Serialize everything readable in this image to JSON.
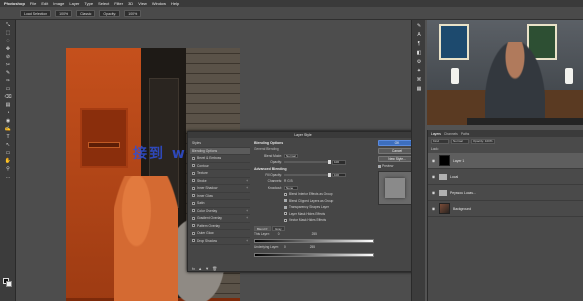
{
  "menubar": {
    "items": [
      "Photoshop",
      "File",
      "Edit",
      "Image",
      "Layer",
      "Type",
      "Select",
      "Filter",
      "3D",
      "View",
      "Window",
      "Help"
    ],
    "right": ""
  },
  "options": {
    "items": [
      "Load Selection",
      "100%",
      "Classic",
      "Opacity:",
      "100%"
    ]
  },
  "toolbar": {
    "tools": [
      "⤡",
      "⬚",
      "◌",
      "✥",
      "⊘",
      "✂",
      "✎",
      "✑",
      "▭",
      "⌫",
      "▤",
      "◔",
      "◉",
      "✍",
      "T",
      "↖",
      "▭",
      "✋",
      "⚲",
      "…"
    ]
  },
  "watermark": {
    "text": "接到 www.advers.cn"
  },
  "dialog": {
    "title": "Layer Style",
    "list": [
      {
        "label": "Styles",
        "checkbox": false,
        "plus": false,
        "selected": false
      },
      {
        "label": "Blending Options",
        "checkbox": false,
        "plus": false,
        "selected": true
      },
      {
        "label": "Bevel & Emboss",
        "checkbox": true,
        "plus": false,
        "selected": false
      },
      {
        "label": "Contour",
        "checkbox": true,
        "plus": false,
        "selected": false
      },
      {
        "label": "Texture",
        "checkbox": true,
        "plus": false,
        "selected": false
      },
      {
        "label": "Stroke",
        "checkbox": true,
        "plus": true,
        "selected": false
      },
      {
        "label": "Inner Shadow",
        "checkbox": true,
        "plus": true,
        "selected": false
      },
      {
        "label": "Inner Glow",
        "checkbox": true,
        "plus": false,
        "selected": false
      },
      {
        "label": "Satin",
        "checkbox": true,
        "plus": false,
        "selected": false
      },
      {
        "label": "Color Overlay",
        "checkbox": true,
        "plus": true,
        "selected": false
      },
      {
        "label": "Gradient Overlay",
        "checkbox": true,
        "plus": true,
        "selected": false
      },
      {
        "label": "Pattern Overlay",
        "checkbox": true,
        "plus": false,
        "selected": false
      },
      {
        "label": "Outer Glow",
        "checkbox": true,
        "plus": false,
        "selected": false
      },
      {
        "label": "Drop Shadow",
        "checkbox": true,
        "plus": true,
        "selected": false
      }
    ],
    "bottom_icons": [
      "fx",
      "▲",
      "▼",
      "🗑"
    ],
    "blending": {
      "head1": "Blending Options",
      "general": "General Blending",
      "blend_mode_label": "Blend Mode:",
      "blend_mode_value": "Normal",
      "opacity_label": "Opacity:",
      "opacity_value": "100",
      "opacity_level": 1.0,
      "head2": "Advanced Blending",
      "fill_label": "Fill Opacity:",
      "fill_value": "100",
      "fill_level": 1.0,
      "channels_label": "Channels:",
      "channels": "R  G  B",
      "knockout_label": "Knockout:",
      "knockout_value": "None",
      "checks": [
        {
          "label": "Blend Interior Effects as Group",
          "on": false
        },
        {
          "label": "Blend Clipped Layers as Group",
          "on": true
        },
        {
          "label": "Transparency Shapes Layer",
          "on": true
        },
        {
          "label": "Layer Mask Hides Effects",
          "on": false
        },
        {
          "label": "Vector Mask Hides Effects",
          "on": false
        }
      ],
      "blend_if_label": "Blend If:",
      "blend_if_value": "Gray",
      "this_layer_label": "This Layer:",
      "this_layer_left": "0",
      "this_layer_right": "255",
      "underlying_label": "Underlying Layer:",
      "underlying_left": "0",
      "underlying_right": "255"
    },
    "buttons": {
      "ok": "OK",
      "cancel": "Cancel",
      "new_style": "New Style...",
      "preview_label": "Preview"
    }
  },
  "right_tools": [
    "✎",
    "A",
    "¶",
    "◧",
    "⚙",
    "✦",
    "⌘",
    "▦"
  ],
  "layers_panel": {
    "tabs": [
      "Layers",
      "Channels",
      "Paths"
    ],
    "filters": [
      "Kind",
      "Normal",
      "Opacity: 100%"
    ],
    "lock_row": "Lock:",
    "layers": [
      {
        "name": "Layer 1",
        "thumb": "mask",
        "visible": true,
        "selected": true,
        "child": false
      },
      {
        "name": "Local",
        "thumb": "folder",
        "visible": true,
        "selected": false,
        "child": false
      },
      {
        "name": "Peyssou Lucas...",
        "thumb": "folder",
        "visible": true,
        "selected": false,
        "child": false
      },
      {
        "name": "Background",
        "thumb": "photo",
        "visible": true,
        "selected": false,
        "child": false
      }
    ]
  }
}
